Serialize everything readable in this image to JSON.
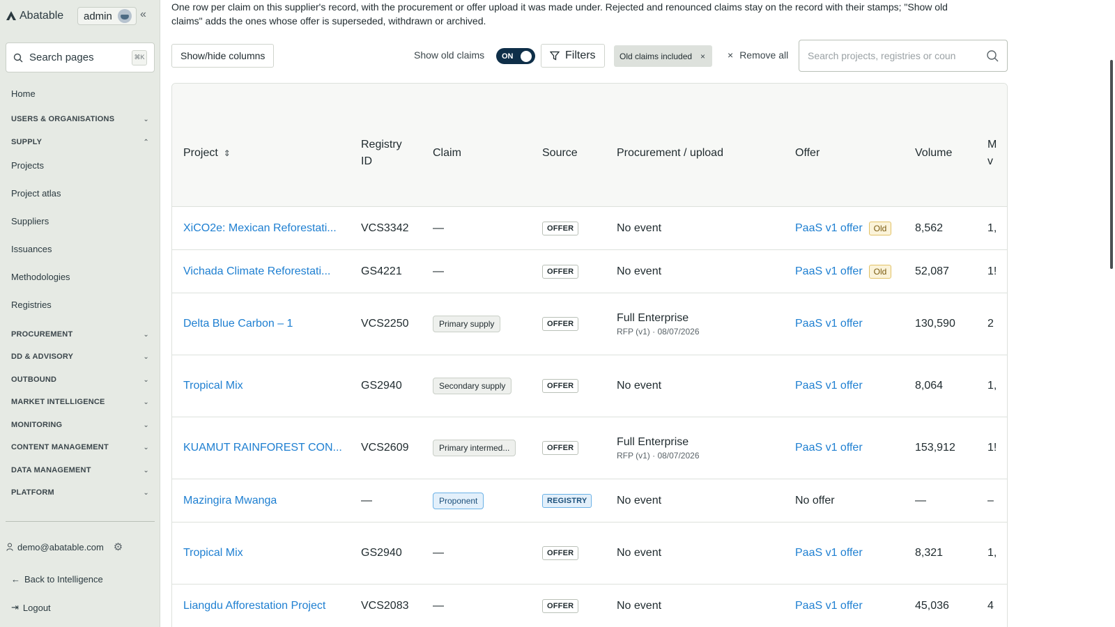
{
  "sidebar": {
    "brand": "Abatable",
    "admin_label": "admin",
    "collapse_glyph": "«",
    "search_placeholder": "Search pages",
    "search_shortcut": "⌘K",
    "items": {
      "home": "Home",
      "users": "USERS & ORGANISATIONS",
      "supply": "SUPPLY",
      "projects": "Projects",
      "atlas": "Project atlas",
      "suppliers": "Suppliers",
      "issuances": "Issuances",
      "methodologies": "Methodologies",
      "registries": "Registries",
      "procurement": "PROCUREMENT",
      "dd": "DD & ADVISORY",
      "outbound": "OUTBOUND",
      "market": "MARKET INTELLIGENCE",
      "monitoring": "MONITORING",
      "content": "CONTENT MANAGEMENT",
      "data": "DATA MANAGEMENT",
      "platform": "PLATFORM"
    },
    "user_email": "demo@abatable.com",
    "back_link": "Back to Intelligence",
    "logout": "Logout"
  },
  "main": {
    "intro": "One row per claim on this supplier's record, with the procurement or offer upload it was made under. Rejected and renounced claims stay on the record with their stamps; \"Show old claims\" adds the ones whose offer is superseded, withdrawn or archived.",
    "toolbar": {
      "show_hide_columns": "Show/hide columns",
      "show_old_claims": "Show old claims",
      "toggle_state": "ON",
      "filters": "Filters",
      "chip": "Old claims included",
      "chip_close": "×",
      "remove_all_x": "×",
      "remove_all": "Remove all",
      "search_placeholder": "Search projects, registries or coun"
    },
    "table": {
      "headers": {
        "project": "Project",
        "registry_id_1": "Registry",
        "registry_id_2": "ID",
        "claim": "Claim",
        "source": "Source",
        "procurement": "Procurement / upload",
        "offer": "Offer",
        "volume": "Volume",
        "next_col_1": "M",
        "next_col_2": "v"
      },
      "rows": [
        {
          "project": "XiCO2e: Mexican Reforestati...",
          "registry": "VCS3342",
          "claim": "—",
          "source": "OFFER",
          "proc": "No event",
          "proc_sub": "",
          "offer": "PaaS v1 offer",
          "old": "Old",
          "volume": "8,562",
          "next": "1,"
        },
        {
          "project": "Vichada Climate Reforestati...",
          "registry": "GS4221",
          "claim": "—",
          "source": "OFFER",
          "proc": "No event",
          "proc_sub": "",
          "offer": "PaaS v1 offer",
          "old": "Old",
          "volume": "52,087",
          "next": "1!"
        },
        {
          "project": "Delta Blue Carbon – 1",
          "registry": "VCS2250",
          "claim": "Primary supply",
          "source": "OFFER",
          "proc": "Full Enterprise",
          "proc_sub": "RFP (v1) · 08/07/2026",
          "offer": "PaaS v1 offer",
          "old": "",
          "volume": "130,590",
          "next": "2"
        },
        {
          "project": "Tropical Mix",
          "registry": "GS2940",
          "claim": "Secondary supply",
          "source": "OFFER",
          "proc": "No event",
          "proc_sub": "",
          "offer": "PaaS v1 offer",
          "old": "",
          "volume": "8,064",
          "next": "1,"
        },
        {
          "project": "KUAMUT RAINFOREST CON...",
          "registry": "VCS2609",
          "claim": "Primary intermed...",
          "source": "OFFER",
          "proc": "Full Enterprise",
          "proc_sub": "RFP (v1) · 08/07/2026",
          "offer": "PaaS v1 offer",
          "old": "",
          "volume": "153,912",
          "next": "1!"
        },
        {
          "project": "Mazingira Mwanga",
          "registry": "—",
          "claim": "Proponent",
          "source": "REGISTRY",
          "proc": "No event",
          "proc_sub": "",
          "offer": "No offer",
          "old": "",
          "volume": "—",
          "next": "–"
        },
        {
          "project": "Tropical Mix",
          "registry": "GS2940",
          "claim": "—",
          "source": "OFFER",
          "proc": "No event",
          "proc_sub": "",
          "offer": "PaaS v1 offer",
          "old": "",
          "volume": "8,321",
          "next": "1,"
        },
        {
          "project": "Liangdu Afforestation Project",
          "registry": "VCS2083",
          "claim": "—",
          "source": "OFFER",
          "proc": "No event",
          "proc_sub": "",
          "offer": "PaaS v1 offer",
          "old": "",
          "volume": "45,036",
          "next": "4"
        }
      ]
    }
  },
  "colors": {
    "sidebar_bg": "#e6eae4",
    "link": "#1e7fd1",
    "toggle_on": "#0f2f49",
    "old_badge": "#fbf3d9",
    "registry_badge": "#e3f0fb"
  }
}
